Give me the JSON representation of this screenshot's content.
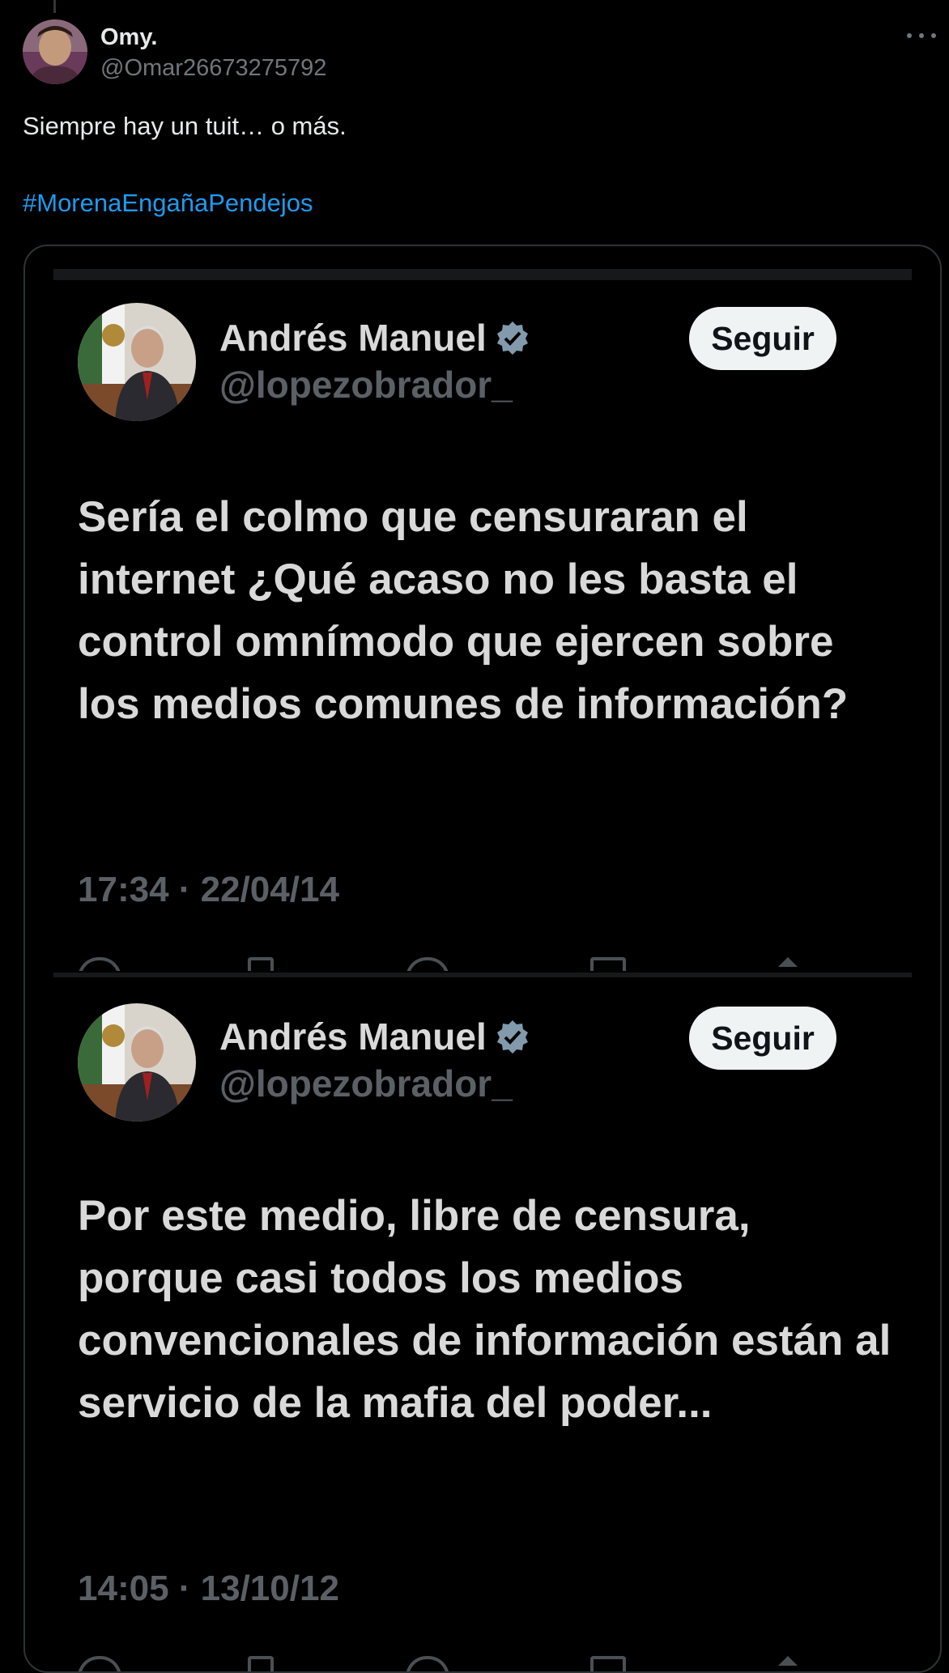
{
  "post": {
    "author_name": "Omy.",
    "author_handle": "@Omar26673275792",
    "text": "Siempre hay un tuit… o más.",
    "hashtag": "#MorenaEngañaPendejos",
    "more_icon": "more-horizontal-icon"
  },
  "embedded_tweets": [
    {
      "name": "Andrés Manuel",
      "handle": "@lopezobrador_",
      "follow_label": "Seguir",
      "text": "Sería el colmo que censuraran el internet ¿Qué acaso no les basta el control omnímodo que ejercen sobre los medios comunes de información?",
      "timestamp": "17:34 · 22/04/14"
    },
    {
      "name": "Andrés Manuel",
      "handle": "@lopezobrador_",
      "follow_label": "Seguir",
      "text": "Por este medio, libre de censura, porque casi todos los medios convencionales de información están al servicio de la mafia del poder...",
      "timestamp": "14:05 · 13/10/12"
    }
  ],
  "colors": {
    "background": "#000000",
    "text_primary": "#e7e9ea",
    "text_secondary": "#71767b",
    "link": "#1d9bf0",
    "verified": "#829aab",
    "follow_bg": "#eff3f4"
  }
}
